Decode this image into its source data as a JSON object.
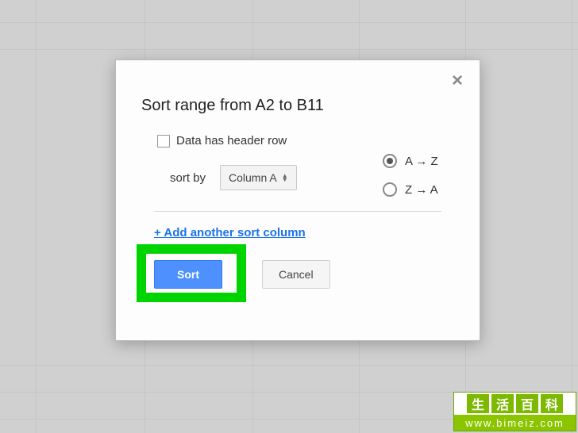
{
  "dialog": {
    "title": "Sort range from A2 to B11",
    "header_checkbox_label": "Data has header row",
    "sort_by_label": "sort by",
    "column_dropdown": "Column A",
    "radio_az": "A → Z",
    "radio_za": "Z → A",
    "add_column_link": "+ Add another sort column",
    "sort_button": "Sort",
    "cancel_button": "Cancel"
  },
  "watermark": {
    "chars": [
      "生",
      "活",
      "百",
      "科"
    ],
    "url": "www.bimeiz.com"
  }
}
